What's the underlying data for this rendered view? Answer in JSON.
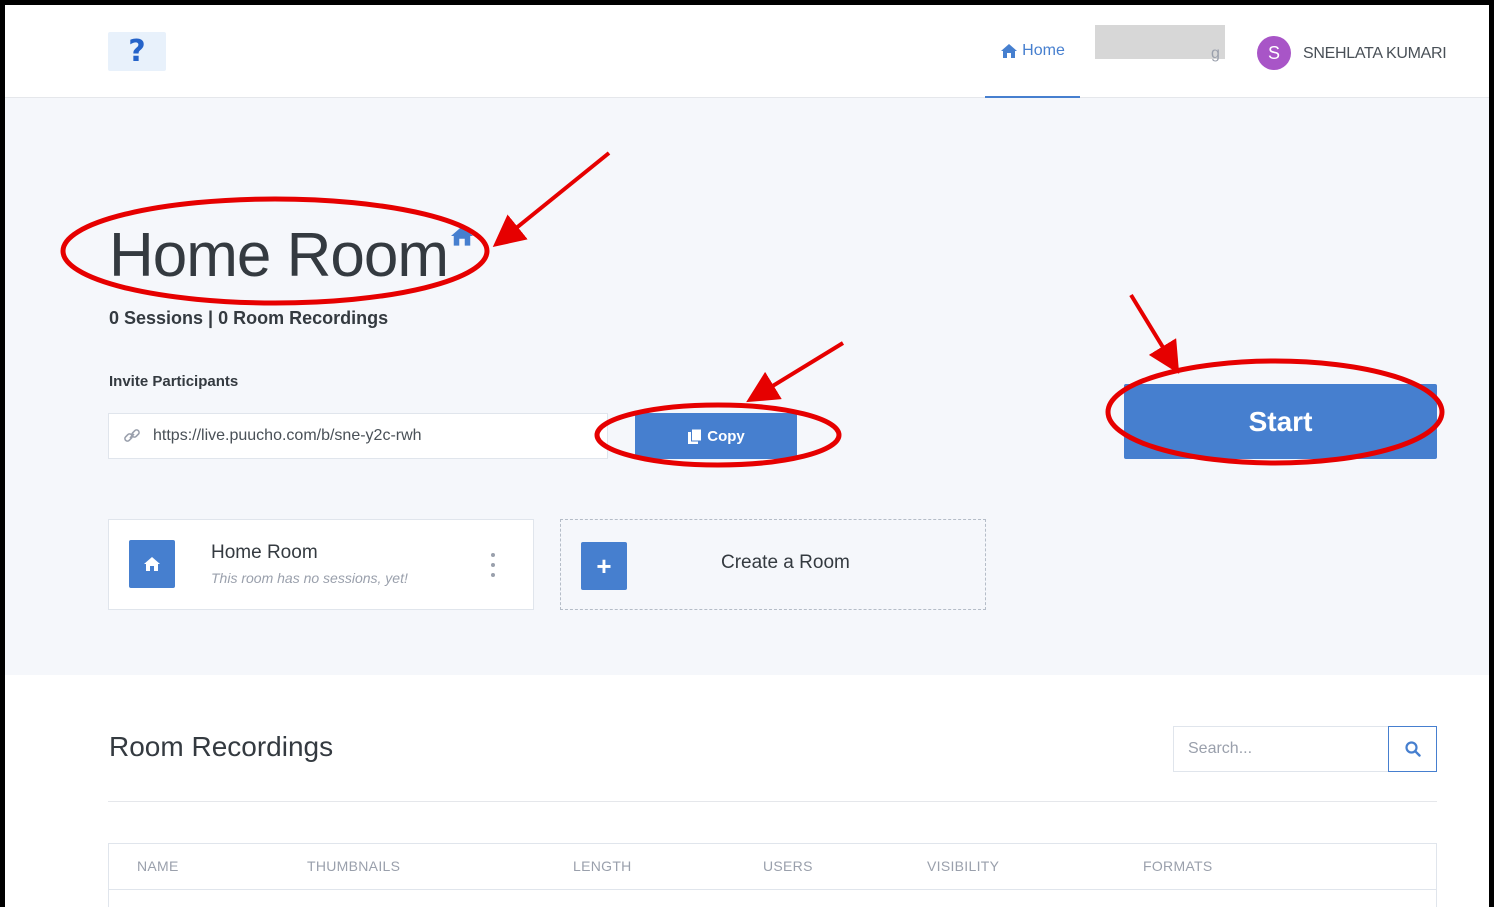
{
  "header": {
    "logo_text": "?",
    "nav_home_label": "Home",
    "user_initial": "S",
    "user_name": "SNEHLATA KUMARI"
  },
  "room": {
    "title": "Home Room",
    "stats": "0 Sessions | 0 Room Recordings",
    "invite_label": "Invite Participants",
    "invite_url": "https://live.puucho.com/b/sne-y2c-rwh",
    "copy_label": "Copy",
    "start_label": "Start"
  },
  "cards": {
    "room_name": "Home Room",
    "room_subtitle": "This room has no sessions, yet!",
    "create_label": "Create a Room",
    "create_icon": "+"
  },
  "recordings": {
    "title": "Room Recordings",
    "search_placeholder": "Search...",
    "columns": [
      "NAME",
      "THUMBNAILS",
      "LENGTH",
      "USERS",
      "VISIBILITY",
      "FORMATS"
    ]
  },
  "colors": {
    "accent": "#467fcf",
    "annotation": "#e60000",
    "avatar": "#a855c7"
  },
  "icons": [
    "home-icon",
    "link-icon",
    "copy-icon",
    "plus-icon",
    "search-icon",
    "kebab-menu-icon"
  ]
}
